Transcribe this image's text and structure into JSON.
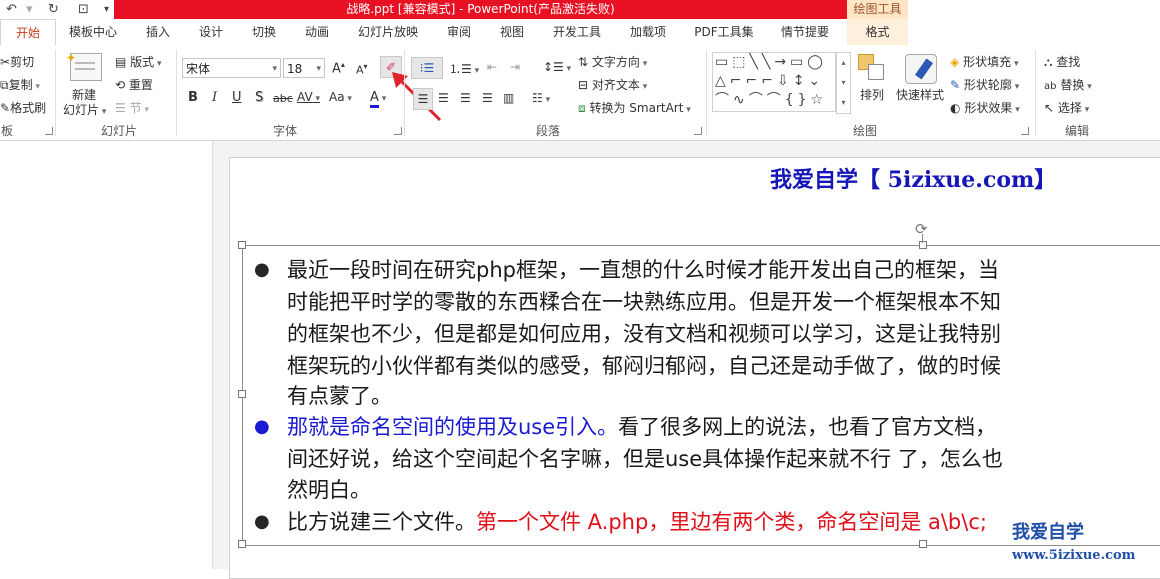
{
  "window": {
    "doc_title": "战略.ppt [兼容模式] - PowerPoint(产品激活失败)",
    "context_tools": "绘图工具"
  },
  "tabs": [
    "开始",
    "模板中心",
    "插入",
    "设计",
    "切换",
    "动画",
    "幻灯片放映",
    "审阅",
    "视图",
    "开发工具",
    "加载项",
    "PDF工具集",
    "情节提要",
    "格式"
  ],
  "ribbon": {
    "clipboard": {
      "cut": "剪切",
      "copy": "复制",
      "format_painter": "格式刷",
      "label": "板"
    },
    "slides": {
      "new_slide_line1": "新建",
      "new_slide_line2": "幻灯片",
      "layout": "版式",
      "reset": "重置",
      "section": "节",
      "label": "幻灯片"
    },
    "font": {
      "font_name": "宋体",
      "font_size": "18",
      "bold": "B",
      "italic": "I",
      "underline": "U",
      "shadow": "S",
      "strike": "abc",
      "spacing": "AV",
      "case": "Aa",
      "color": "A",
      "grow": "A",
      "shrink": "A",
      "label": "字体"
    },
    "paragraph": {
      "text_direction": "文字方向",
      "align_text": "对齐文本",
      "smartart": "转换为 SmartArt",
      "label": "段落"
    },
    "drawing": {
      "arrange": "排列",
      "quick_styles": "快速样式",
      "shape_fill": "形状填充",
      "shape_outline": "形状轮廓",
      "shape_effects": "形状效果",
      "label": "绘图"
    },
    "editing": {
      "find": "查找",
      "replace": "替换",
      "select": "选择",
      "label": "编辑"
    }
  },
  "slide": {
    "header": "我爱自学【 5izixue.com】",
    "lines": [
      {
        "bullet": true,
        "bullet_color": "#000000",
        "segments": [
          {
            "text": "最近一段时间在研究php框架，一直想的什么时候才能开发出自己的框架，当",
            "color": "#1a1a1a"
          }
        ]
      },
      {
        "bullet": false,
        "segments": [
          {
            "text": "时能把平时学的零散的东西糅合在一块熟练应用。但是开发一个框架根本不知",
            "color": "#1a1a1a"
          }
        ]
      },
      {
        "bullet": false,
        "segments": [
          {
            "text": "的框架也不少，但是都是如何应用，没有文档和视频可以学习，这是让我特别",
            "color": "#1a1a1a"
          }
        ]
      },
      {
        "bullet": false,
        "segments": [
          {
            "text": "框架玩的小伙伴都有类似的感受，郁闷归郁闷，自己还是动手做了，做的时候",
            "color": "#1a1a1a"
          }
        ]
      },
      {
        "bullet": false,
        "segments": [
          {
            "text": "有点蒙了。",
            "color": "#1a1a1a"
          }
        ]
      },
      {
        "bullet": true,
        "bullet_color": "#1a1ad2",
        "segments": [
          {
            "text": "那就是命名空间的使用及use引入。",
            "color": "#1a1ad2"
          },
          {
            "text": "看了很多网上的说法，也看了官方文档，",
            "color": "#1a1a1a"
          }
        ]
      },
      {
        "bullet": false,
        "segments": [
          {
            "text": "间还好说，给这个空间起个名字嘛，但是use具体操作起来就不行 了，怎么也",
            "color": "#1a1a1a"
          }
        ]
      },
      {
        "bullet": false,
        "segments": [
          {
            "text": "然明白。",
            "color": "#1a1a1a"
          }
        ]
      },
      {
        "bullet": true,
        "bullet_color": "#000000",
        "segments": [
          {
            "text": "比方说建三个文件。",
            "color": "#1a1a1a"
          },
          {
            "text": "第一个文件 A.php，里边有两个类，命名空间是 a\\b\\c;",
            "color": "#e0101a"
          }
        ]
      }
    ]
  },
  "watermark": {
    "line1": "我爱自学",
    "line2": "www.5izixue.com"
  }
}
